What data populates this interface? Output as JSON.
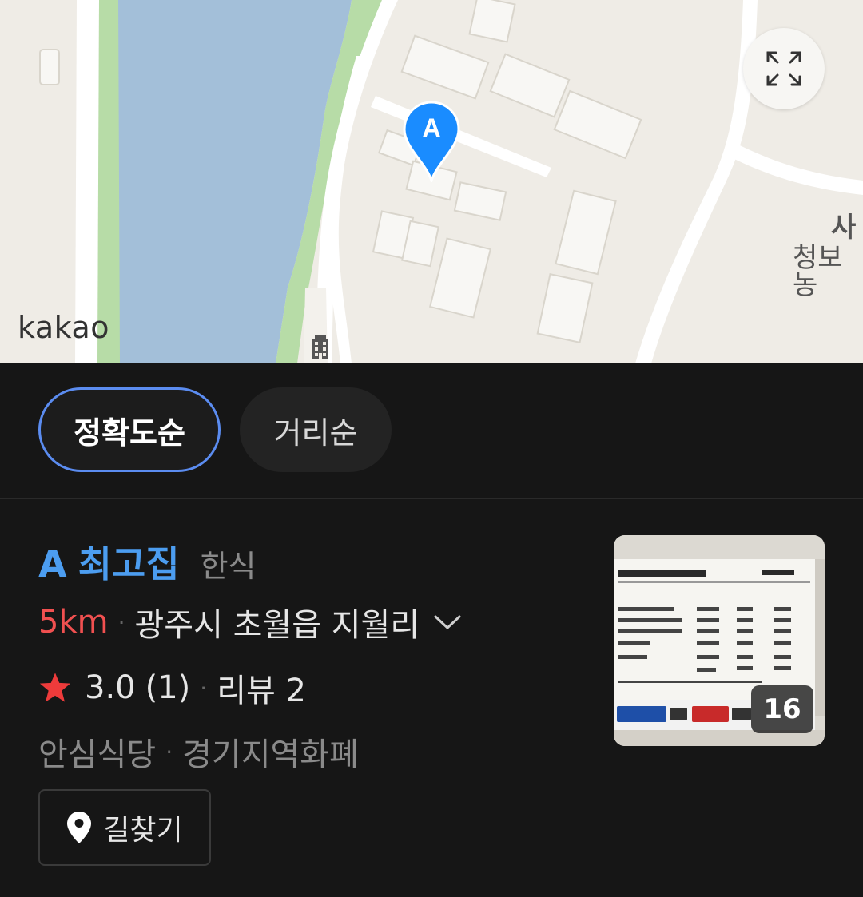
{
  "map": {
    "logo": "kakao",
    "marker_letter": "A",
    "poi_label_1": "사",
    "poi_label_2": "청보농"
  },
  "sort": {
    "accuracy_label": "정확도순",
    "distance_label": "거리순",
    "selected": "accuracy"
  },
  "place": {
    "marker": "A",
    "name": "최고집",
    "category": "한식",
    "distance": "5km",
    "address": "광주시 초월읍 지월리",
    "rating": "3.0",
    "rating_count": "(1)",
    "review_label": "리뷰 2",
    "tag_1": "안심식당",
    "tag_2": "경기지역화폐",
    "route_label": "길찾기",
    "photo_count": "16"
  },
  "colors": {
    "accent_blue": "#4c9df0",
    "chip_border": "#5b8cf0",
    "distance_red": "#f15050",
    "star_red": "#ee3b3b",
    "marker_blue": "#1a8cff"
  },
  "icons": [
    "expand-icon",
    "map-marker-icon",
    "building-icon",
    "chevron-down-icon",
    "star-icon",
    "location-pin-icon"
  ]
}
